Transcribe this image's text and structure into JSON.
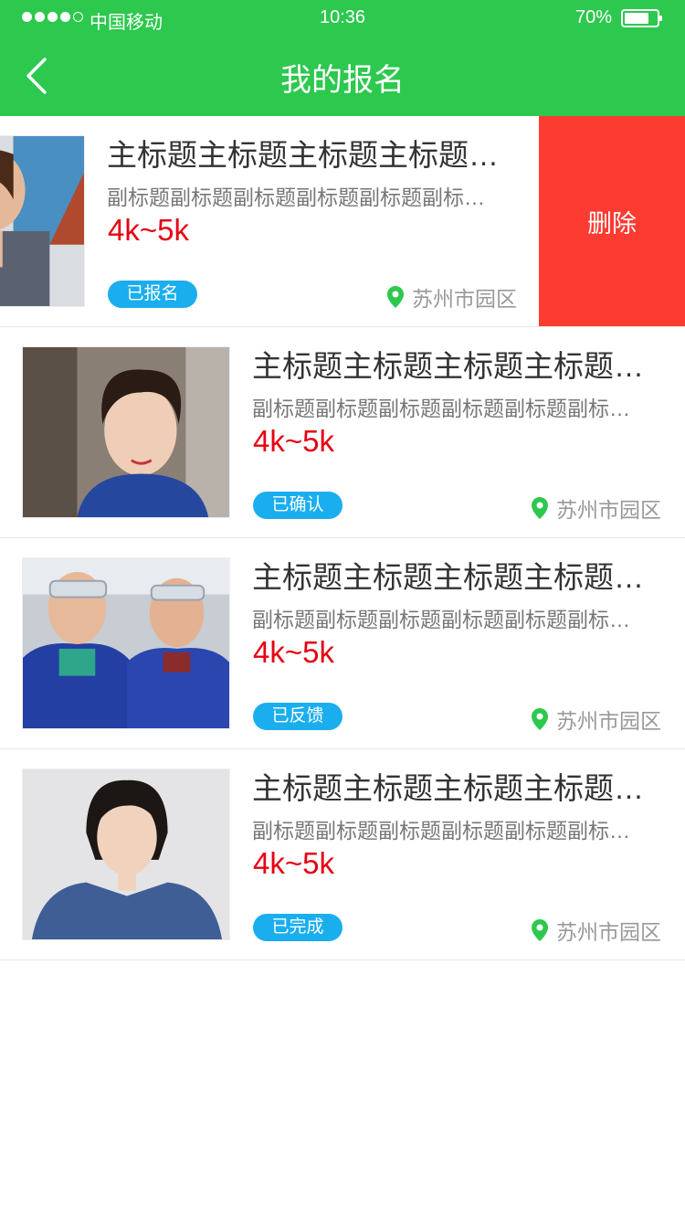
{
  "status_bar": {
    "carrier": "中国移动",
    "time": "10:36",
    "battery": "70%"
  },
  "header": {
    "title": "我的报名",
    "back_icon": "chevron-left-icon"
  },
  "colors": {
    "brand_green": "#2dc84e",
    "salary_red": "#e60012",
    "badge_blue": "#1aaeee",
    "delete_red": "#fc3b31"
  },
  "list": {
    "items": [
      {
        "title": "主标题主标题主标题主标题主标题",
        "subtitle": "副标题副标题副标题副标题副标题副标题副标题",
        "salary": "4k~5k",
        "status": "已报名",
        "location": "苏州市园区",
        "swiped": true,
        "delete_label": "删除"
      },
      {
        "title": "主标题主标题主标题主标题主标题",
        "subtitle": "副标题副标题副标题副标题副标题副标题副标题",
        "salary": "4k~5k",
        "status": "已确认",
        "location": "苏州市园区"
      },
      {
        "title": "主标题主标题主标题主标题主标题",
        "subtitle": "副标题副标题副标题副标题副标题副标题副标题",
        "salary": "4k~5k",
        "status": "已反馈",
        "location": "苏州市园区"
      },
      {
        "title": "主标题主标题主标题主标题主标题",
        "subtitle": "副标题副标题副标题副标题副标题副标题副标题",
        "salary": "4k~5k",
        "status": "已完成",
        "location": "苏州市园区"
      }
    ]
  }
}
